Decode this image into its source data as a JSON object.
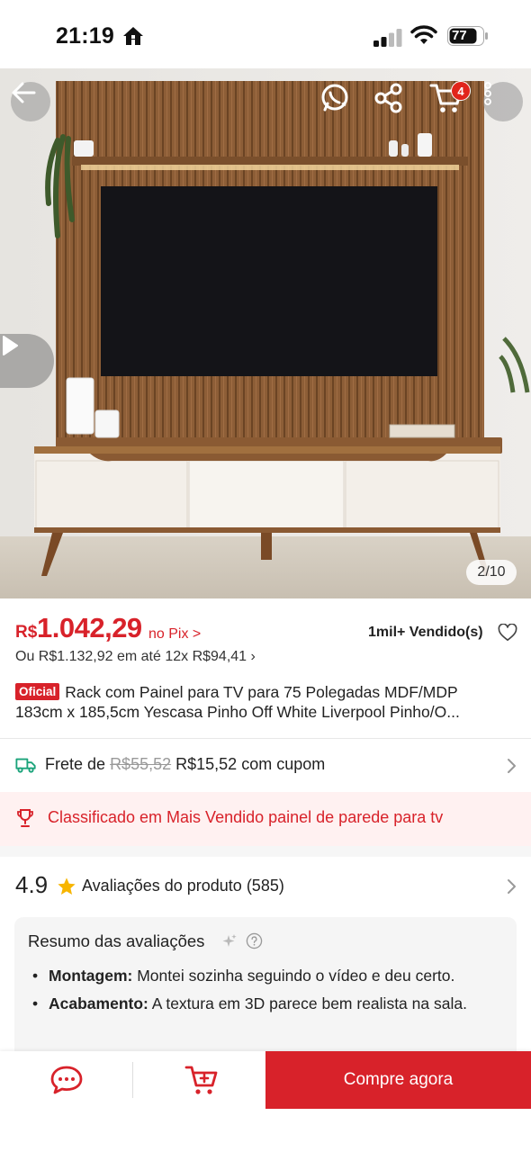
{
  "status_bar": {
    "time": "21:19",
    "battery": "77"
  },
  "image": {
    "counter": "2/10",
    "cart_count": "4"
  },
  "price": {
    "currency": "R$",
    "value": "1.042,29",
    "pix_label": "no Pix >",
    "installments": "Ou R$1.132,92 em até 12x R$94,41 ›",
    "sold": "1mil+ Vendido(s)"
  },
  "product": {
    "badge": "Oficial",
    "title_line1": "Rack com Painel para TV para 75 Polegadas MDF/MDP",
    "title_line2": "183cm x 185,5cm Yescasa Pinho Off White Liverpool Pinho/O..."
  },
  "shipping": {
    "prefix": "Frete de",
    "old_price": "R$55,52",
    "new_price": "R$15,52 com cupom"
  },
  "ranking": {
    "text": "Classificado em Mais Vendido painel de parede para tv"
  },
  "rating": {
    "score": "4.9",
    "label": "Avaliações do produto",
    "count": "(585)"
  },
  "summary": {
    "title": "Resumo das avaliações",
    "items": [
      {
        "key": "Montagem:",
        "text": "Montei sozinha seguindo o vídeo e deu certo."
      },
      {
        "key": "Acabamento:",
        "text": "A textura em 3D parece bem realista na sala."
      }
    ]
  },
  "bottom_bar": {
    "buy_label": "Compre agora"
  },
  "colors": {
    "accent": "#d8222a",
    "rank_bg": "#fff1f1",
    "wood": "#8a5a33",
    "cabinet": "#f3efe9"
  },
  "icons": [
    "home-icon",
    "signal-icon",
    "wifi-icon",
    "battery-icon",
    "back-arrow-icon",
    "whatsapp-icon",
    "share-icon",
    "cart-icon",
    "more-vertical-icon",
    "play-icon",
    "heart-icon",
    "truck-icon",
    "chevron-right-icon",
    "trophy-icon",
    "star-icon",
    "sparkle-icon",
    "help-circle-icon",
    "chat-icon",
    "add-to-cart-icon"
  ]
}
